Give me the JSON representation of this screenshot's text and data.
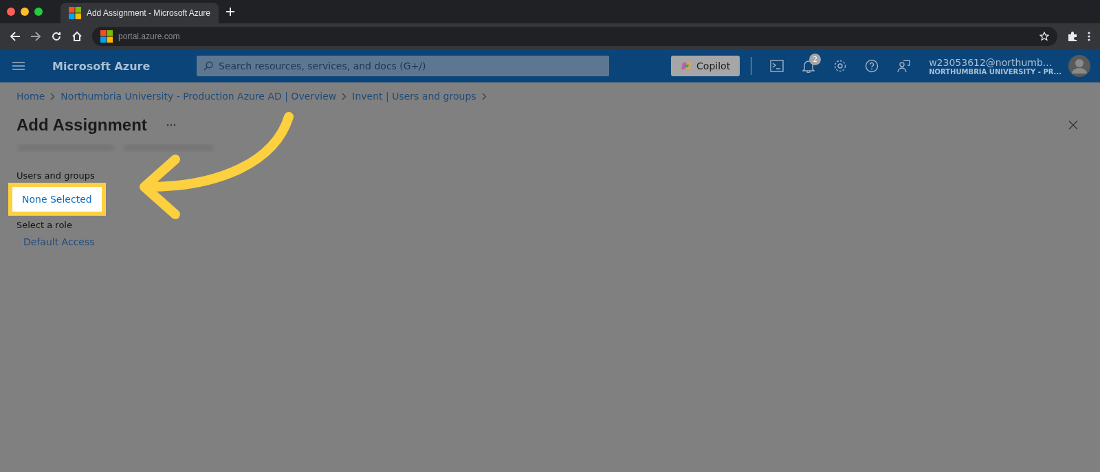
{
  "browser": {
    "tab": {
      "title": "Add Assignment - Microsoft Azure"
    },
    "address": "portal.azure.com"
  },
  "header": {
    "brand": "Microsoft Azure",
    "search": {
      "placeholder": "Search resources, services, and docs (G+/)"
    },
    "copilot": "Copilot",
    "notifications_count": "2",
    "account": {
      "email": "w23053612@northumb...",
      "org": "NORTHUMBRIA UNIVERSITY - PR..."
    }
  },
  "breadcrumbs": [
    "Home",
    "Northumbria University - Production Azure AD | Overview",
    "Invent | Users and groups"
  ],
  "page": {
    "title": "Add Assignment"
  },
  "fields": [
    {
      "label": "Users and groups",
      "value": "None Selected",
      "highlighted": true
    },
    {
      "label": "Select a role",
      "value": "Default Access",
      "highlighted": false
    }
  ]
}
